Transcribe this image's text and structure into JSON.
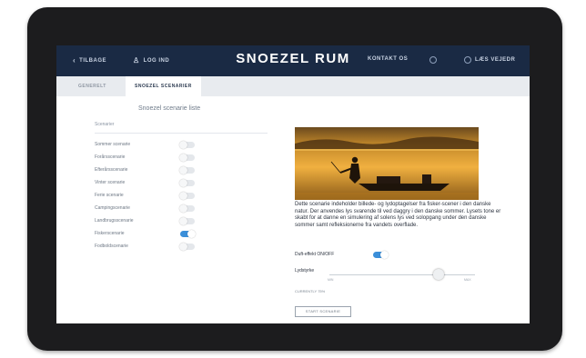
{
  "header": {
    "back_label": "TILBAGE",
    "login_label": "LOG IND",
    "title": "SNOEZEL RUM",
    "contact_label": "KONTAKT OS",
    "read_label": "LÆS VEJEDR"
  },
  "tabs": [
    {
      "label": "GENERELT",
      "active": false
    },
    {
      "label": "SNOEZEL SCENARIER",
      "active": true
    }
  ],
  "scenario_list": {
    "title": "Snoezel scenarie liste",
    "section_label": "Scenarier",
    "items": [
      {
        "label": "Sommer scenarie",
        "enabled": false
      },
      {
        "label": "Forårsscenarie",
        "enabled": false
      },
      {
        "label": "Efterårsscenarie",
        "enabled": false
      },
      {
        "label": "Vinter scenarie",
        "enabled": false
      },
      {
        "label": "Ferie scenarie",
        "enabled": false
      },
      {
        "label": "Campingscenarie",
        "enabled": false
      },
      {
        "label": "Landbrugsscenarie",
        "enabled": false
      },
      {
        "label": "Fiskerscenarie",
        "enabled": true
      },
      {
        "label": "Fodboldscenarie",
        "enabled": false
      }
    ]
  },
  "detail": {
    "description": "Dette scenarie indeholder billede- og lydoptagelser fra fisker-scener i den danske natur. Der anvendes lys svarende til ved daggry i den danske sommer. Lysets tone er skabt for at danne en simulering af solens lys ved solopgang under den danske sommer samt refleksionerne fra vandets overflade.",
    "scent_label": "Duft-effekt ON/OFF",
    "scent_on": true,
    "volume_label": "Lydstyrke",
    "volume_min_label": "MIN",
    "volume_max_label": "MAX",
    "volume_level": 0.75,
    "current_label": "CURRENTLY 75%",
    "start_button": "START SCENARIE"
  },
  "colors": {
    "topbar": "#1a2a44",
    "toggle_on": "#3b8fd9"
  }
}
